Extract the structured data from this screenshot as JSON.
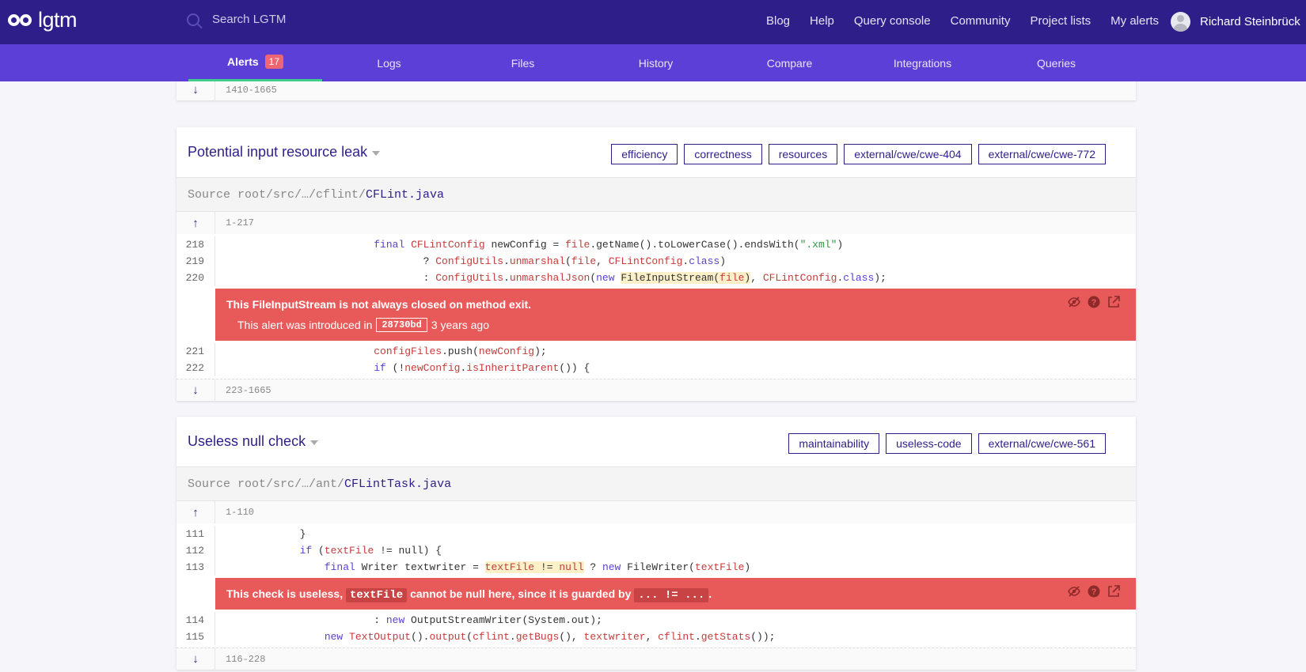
{
  "header": {
    "logo_text": "lgtm",
    "search_placeholder": "Search LGTM",
    "nav": [
      "Blog",
      "Help",
      "Query console",
      "Community",
      "Project lists",
      "My alerts"
    ],
    "user_name": "Richard Steinbrück"
  },
  "subnav": {
    "tabs": [
      "Alerts",
      "Logs",
      "Files",
      "History",
      "Compare",
      "Integrations",
      "Queries"
    ],
    "alerts_count": "17"
  },
  "top_gap": {
    "range": "1410-1665",
    "arrow": "↓"
  },
  "alert1": {
    "title": "Potential input resource leak",
    "tags": [
      "efficiency",
      "correctness",
      "resources",
      "external/cwe/cwe-404",
      "external/cwe/cwe-772"
    ],
    "source_prefix": "Source root/src/…/cflint/",
    "source_file": "CFLint.java",
    "gap_top": {
      "arrow": "↑",
      "range": "1-217"
    },
    "lines": [
      "218",
      "219",
      "220",
      "221",
      "222"
    ],
    "message": "This FileInputStream is not always closed on method exit.",
    "sub_prefix": "This alert was introduced in",
    "commit": "28730bd",
    "sub_suffix": "3 years ago",
    "gap_bottom": {
      "arrow": "↓",
      "range": "223-1665"
    }
  },
  "alert2": {
    "title": "Useless null check",
    "tags": [
      "maintainability",
      "useless-code",
      "external/cwe/cwe-561"
    ],
    "source_prefix": "Source root/src/…/ant/",
    "source_file": "CFLintTask.java",
    "gap_top": {
      "arrow": "↑",
      "range": "1-110"
    },
    "lines": [
      "111",
      "112",
      "113",
      "114",
      "115"
    ],
    "message_parts": [
      "This check is useless, ",
      "textFile",
      " cannot be null here, since it is guarded by ",
      "... != ...",
      "."
    ],
    "gap_bottom": {
      "arrow": "↓",
      "range": "116-228"
    }
  },
  "colors": {
    "header": "#2e1e8a",
    "subnav": "#5b3fd6",
    "alert": "#e85959",
    "active_tab": "#3ecf8e"
  },
  "icons": [
    "search-icon",
    "hide-alert-icon",
    "help-icon",
    "external-link-icon"
  ]
}
